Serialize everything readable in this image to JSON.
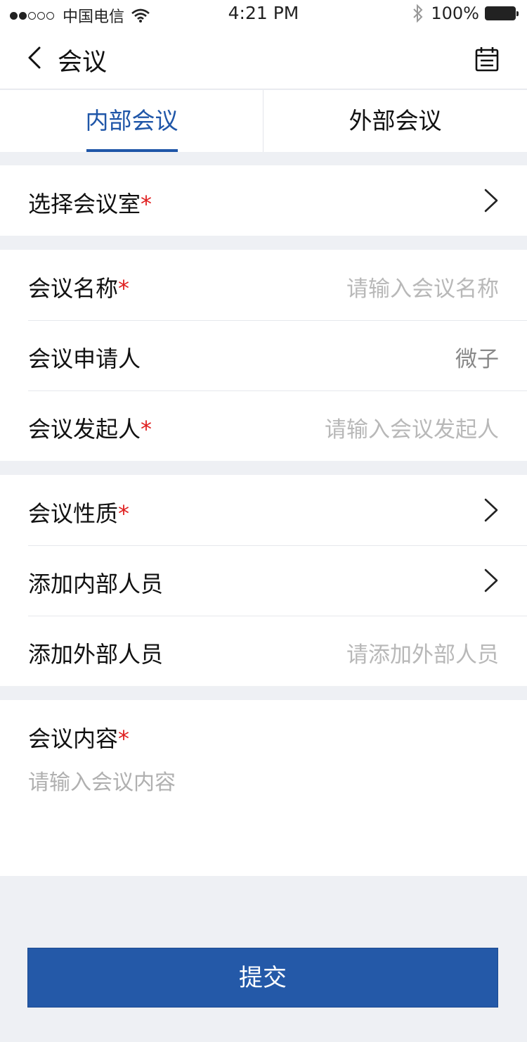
{
  "status_bar": {
    "carrier": "中国电信",
    "time": "4:21 PM",
    "battery": "100%"
  },
  "nav": {
    "title": "会议",
    "back_icon": "chevron-left-icon",
    "calendar_icon": "calendar-icon"
  },
  "tabs": [
    {
      "label": "内部会议",
      "active": true
    },
    {
      "label": "外部会议",
      "active": false
    }
  ],
  "form": {
    "room": {
      "label": "选择会议室",
      "required_mark": "*"
    },
    "name": {
      "label": "会议名称",
      "required_mark": "*",
      "placeholder": "请输入会议名称"
    },
    "applicant": {
      "label": "会议申请人",
      "value": "微子"
    },
    "initiator": {
      "label": "会议发起人",
      "required_mark": "*",
      "placeholder": "请输入会议发起人"
    },
    "nature": {
      "label": "会议性质",
      "required_mark": "*"
    },
    "internal_members": {
      "label": "添加内部人员"
    },
    "external_members": {
      "label": "添加外部人员",
      "placeholder": "请添加外部人员"
    },
    "content": {
      "label": "会议内容",
      "required_mark": "*",
      "placeholder": "请输入会议内容"
    }
  },
  "submit_label": "提交",
  "colors": {
    "accent": "#1f56a8",
    "button": "#2459a8",
    "required": "#e02020",
    "background": "#eef0f4"
  }
}
